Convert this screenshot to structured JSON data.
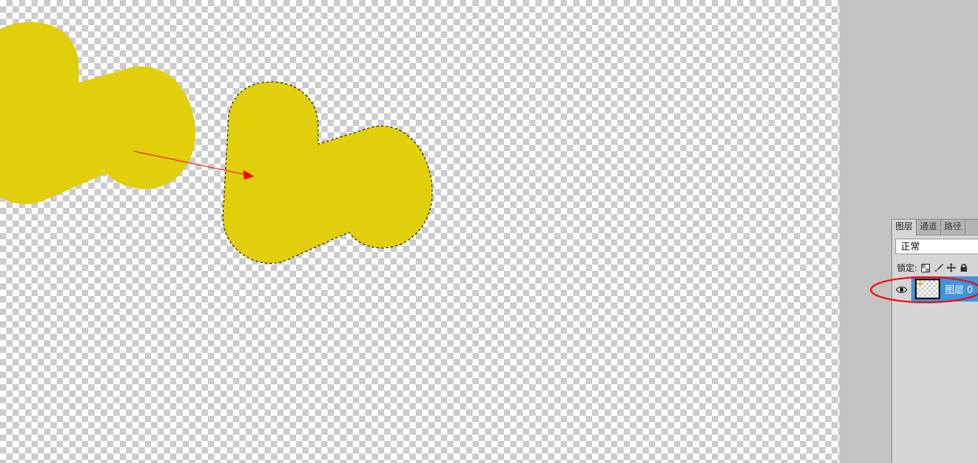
{
  "colors": {
    "shape_fill": "#e0cf0a",
    "layer_selected": "#3f94dc",
    "annotation_red": "#ff0000"
  },
  "layers_panel": {
    "tabs": [
      {
        "label": "图层",
        "active": true
      },
      {
        "label": "通道",
        "active": false
      },
      {
        "label": "路径",
        "active": false
      }
    ],
    "blend_mode": "正常",
    "lock_label": "锁定:",
    "lock_icons": [
      "lock-transparent-icon",
      "lock-paint-icon",
      "lock-move-icon",
      "lock-all-icon"
    ],
    "layers": [
      {
        "name": "图层 0",
        "visible": true,
        "selected": true,
        "visibility_icon": "eye-icon"
      }
    ]
  }
}
